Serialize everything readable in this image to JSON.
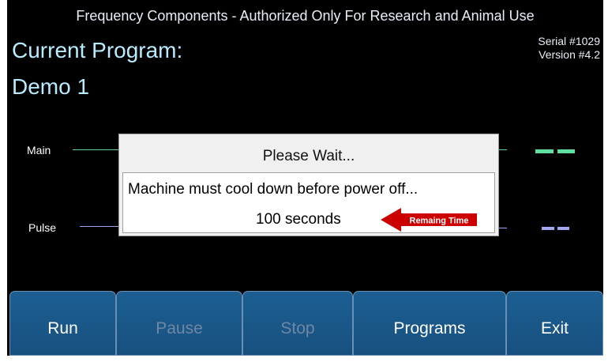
{
  "header": {
    "title": "Frequency Components - Authorized Only For Research and Animal Use",
    "serial": "Serial #1029",
    "version": "Version #4.2"
  },
  "program": {
    "label": "Current Program:",
    "name": "Demo 1"
  },
  "channels": {
    "main": {
      "label": "Main",
      "color": "#5fe0a0"
    },
    "pulse": {
      "label": "Pulse",
      "color": "#a2a7ee"
    }
  },
  "dialog": {
    "title": "Please Wait...",
    "message": "Machine must cool down before power off...",
    "countdown": "100 seconds",
    "arrow_label": "Remaing Time",
    "arrow_color": "#cc0000"
  },
  "buttons": {
    "run": "Run",
    "pause": "Pause",
    "stop": "Stop",
    "programs": "Programs",
    "exit": "Exit"
  },
  "colors": {
    "background": "#000000",
    "accent_text": "#b7ecff",
    "button": "#1d5f93"
  }
}
